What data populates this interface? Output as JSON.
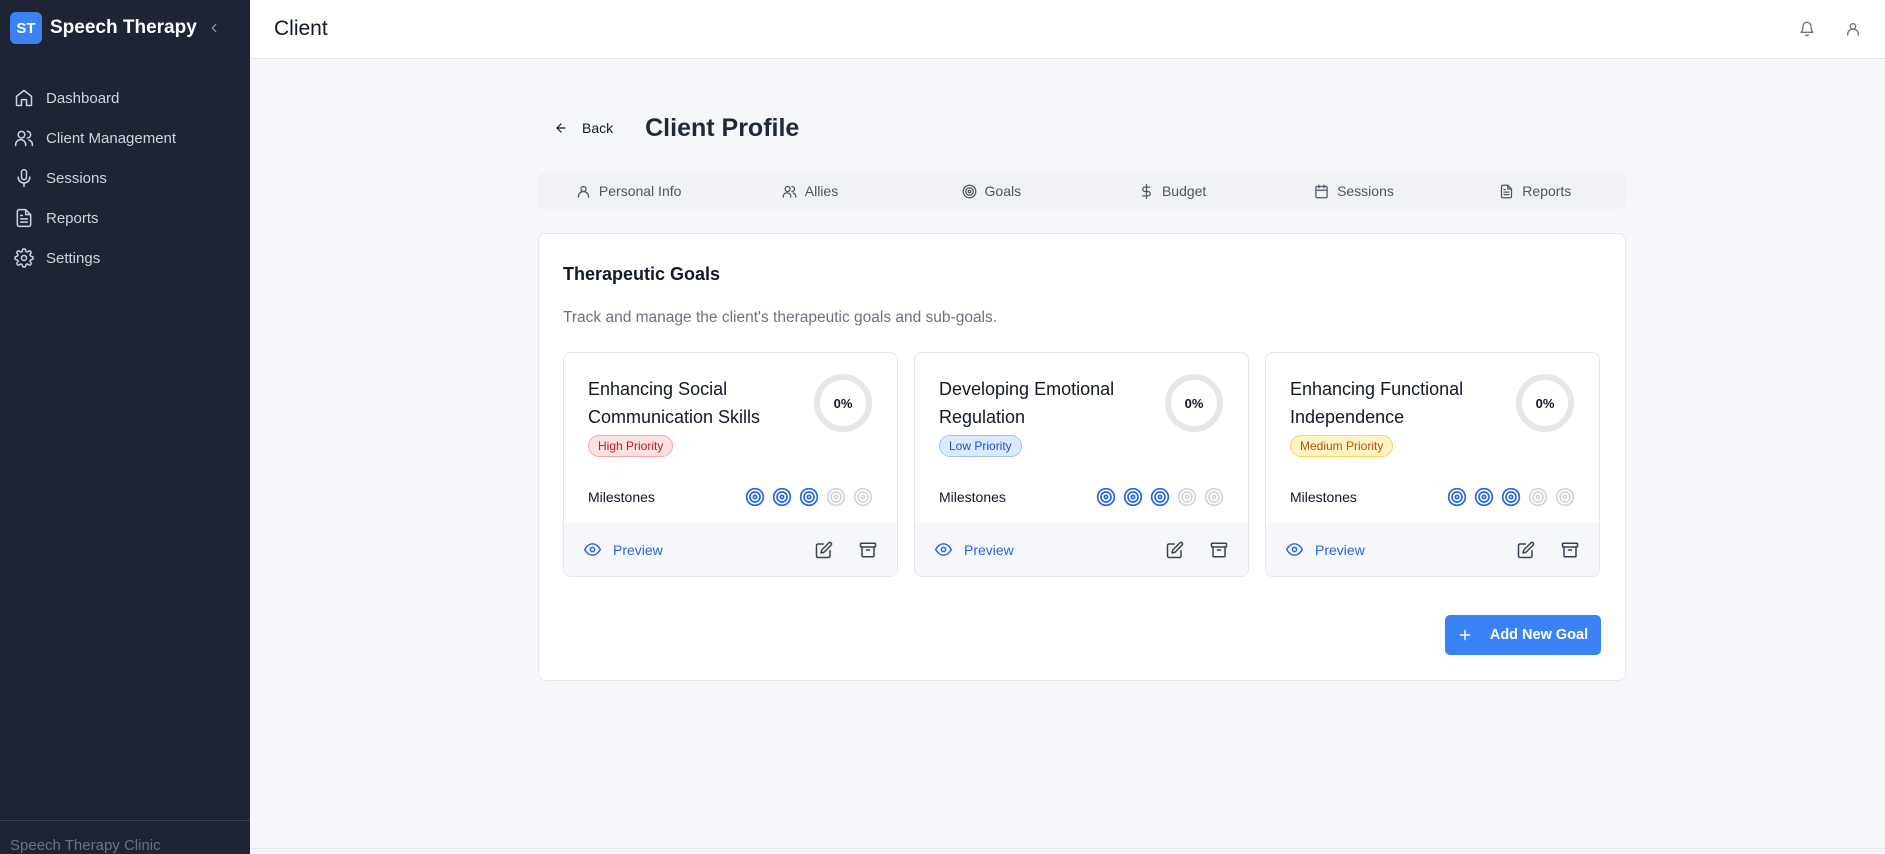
{
  "brand": {
    "initials": "ST",
    "name": "Speech Therapy"
  },
  "sidebar": {
    "items": [
      {
        "label": "Dashboard",
        "icon": "home-icon"
      },
      {
        "label": "Client Management",
        "icon": "users-icon"
      },
      {
        "label": "Sessions",
        "icon": "microphone-icon"
      },
      {
        "label": "Reports",
        "icon": "file-text-icon"
      },
      {
        "label": "Settings",
        "icon": "gear-icon"
      }
    ],
    "footer": "Speech Therapy Clinic"
  },
  "topbar": {
    "title": "Client",
    "icons": [
      "bell-icon",
      "user-icon"
    ]
  },
  "profile": {
    "back_label": "Back",
    "title": "Client Profile"
  },
  "tabs": [
    {
      "label": "Personal Info",
      "icon": "user-icon"
    },
    {
      "label": "Allies",
      "icon": "users-icon"
    },
    {
      "label": "Goals",
      "icon": "target-icon"
    },
    {
      "label": "Budget",
      "icon": "dollar-icon"
    },
    {
      "label": "Sessions",
      "icon": "calendar-icon"
    },
    {
      "label": "Reports",
      "icon": "file-text-icon"
    }
  ],
  "panel": {
    "title": "Therapeutic Goals",
    "description": "Track and manage the client's therapeutic goals and sub-goals.",
    "add_button": "Add New Goal"
  },
  "goals": [
    {
      "title": "Enhancing Social Communication Skills",
      "priority": "High Priority",
      "progress_text": "0%",
      "progress": 0,
      "milestones_label": "Milestones",
      "milestones_done": 3,
      "milestones_total": 5,
      "preview": "Preview"
    },
    {
      "title": "Developing Emotional Regulation",
      "priority": "Low Priority",
      "progress_text": "0%",
      "progress": 0,
      "milestones_label": "Milestones",
      "milestones_done": 3,
      "milestones_total": 5,
      "preview": "Preview"
    },
    {
      "title": "Enhancing Functional Independence",
      "priority": "Medium Priority",
      "progress_text": "0%",
      "progress": 0,
      "milestones_label": "Milestones",
      "milestones_done": 3,
      "milestones_total": 5,
      "preview": "Preview"
    }
  ],
  "colors": {
    "accent": "#3b82f6",
    "sidebar_bg": "#1e2433",
    "high_priority": "#dc2626",
    "low_priority": "#2563eb",
    "medium_priority": "#b45309"
  }
}
